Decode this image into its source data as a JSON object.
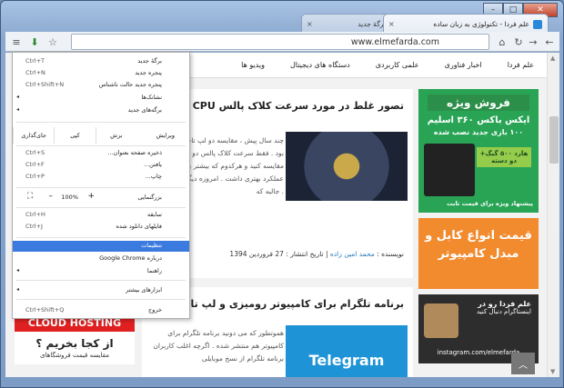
{
  "window": {
    "controls": {
      "minimize": "–",
      "maximize": "□",
      "close": "✕"
    }
  },
  "tabs": [
    {
      "title": "علم فردا - تکنولوژی به زبان ساده",
      "favicon_color": "#2a88d8",
      "close": "×"
    },
    {
      "title": "برگهٔ جدید",
      "close": "×"
    }
  ],
  "toolbar": {
    "url": "www.elmefarda.com",
    "back_icon": "←",
    "forward_icon": "→",
    "reload_icon": "↻",
    "home_icon": "⌂",
    "menu_icon": "≡",
    "star_icon": "☆"
  },
  "site_nav": [
    "علم فردا",
    "اخبار فناوری",
    "علمی کاربردی",
    "دستگاه های دیجیتال",
    "ویدیو ها"
  ],
  "sidebar": {
    "promo": {
      "title": "فروش ویژه",
      "line1": "ایکس باکس ۳۶۰ اسلیم",
      "line2": "۱۰۰ بازی جدید نصب شده",
      "pill": "هارد ۵۰۰ گیگ+ دو دسته",
      "foot": "پیشنهاد ویژه برای قیمت ثابت"
    },
    "cable": "قیمت انواع کابل و مبدل کامپیوتر",
    "insta": {
      "line1": "علم فردا رو در",
      "line2": "اینستاگرام دنبال کنید",
      "url": "instagram.com/elmefarda"
    }
  },
  "articles": [
    {
      "title": "تصور غلط در مورد سرعت کلاک پالس CPU",
      "body": "چند سال پیش ، مقایسه دو لپ تاپ خیلی ساده بود . فقط سرعت کلاک پالس دو تا پردازنده رو مقایسه کنید و هرکدوم که بیشتر بود قطع ، عملکرد بهتری داشت . امروزه دیگه فرق میکنه . جالبه که",
      "more": "[...]",
      "author_label": "نویسنده",
      "author": "محمد امین زاده",
      "date_label": "تاریخ انتشار",
      "date": "27 فروردین 1394"
    },
    {
      "title": "برنامه تلگرام برای کامپیوتر رومیزی و لپ تاپ",
      "thumb_text": "Telegram",
      "body": "هموتطور که می دونید برنامه تلگرام برای کامپیوتر هم منتشر شده . اگرچه اغلب کاربران برنامه تلگرام از نسخ موبایلی"
    }
  ],
  "left_ad": {
    "banner": "CLOUD HOSTING",
    "headline": "از کجا بخریم ؟",
    "sub": "مقایسه قیمت فروشگاهای"
  },
  "menu": {
    "items": [
      {
        "label": "برگهٔ جدید",
        "shortcut": "Ctrl+T"
      },
      {
        "label": "پنجره جدید",
        "shortcut": "Ctrl+N"
      },
      {
        "label": "پنجره جدید حالت ناشناس",
        "shortcut": "Ctrl+Shift+N"
      },
      {
        "label": "نشانک‌ها",
        "arrow": "◂"
      },
      {
        "label": "برگه‌های جدید",
        "arrow": "◂"
      }
    ],
    "edit": {
      "label": "ویرایش",
      "cut": "برش",
      "copy": "کپی",
      "paste": "جای‌گذاری"
    },
    "items2": [
      {
        "label": "ذخیره صفحه بعنوان...",
        "shortcut": "Ctrl+S"
      },
      {
        "label": "یافتن...",
        "shortcut": "Ctrl+F"
      },
      {
        "label": "چاپ...",
        "shortcut": "Ctrl+P"
      }
    ],
    "zoom": {
      "label": "بزرگنمایی",
      "plus": "+",
      "value": "100%",
      "minus": "–",
      "fullscreen": "⛶"
    },
    "items3": [
      {
        "label": "سابقه",
        "shortcut": "Ctrl+H"
      },
      {
        "label": "فایلهای دانلود شده",
        "shortcut": "Ctrl+J"
      }
    ],
    "settings": "تنظیمات",
    "about": "درباره Google Chrome",
    "help": {
      "label": "راهنما",
      "arrow": "◂"
    },
    "more_tools": {
      "label": "ابزارهای بیشتر",
      "arrow": "◂"
    },
    "exit": {
      "label": "خروج",
      "shortcut": "Ctrl+Shift+Q"
    }
  },
  "scroll_up_button": "︿"
}
